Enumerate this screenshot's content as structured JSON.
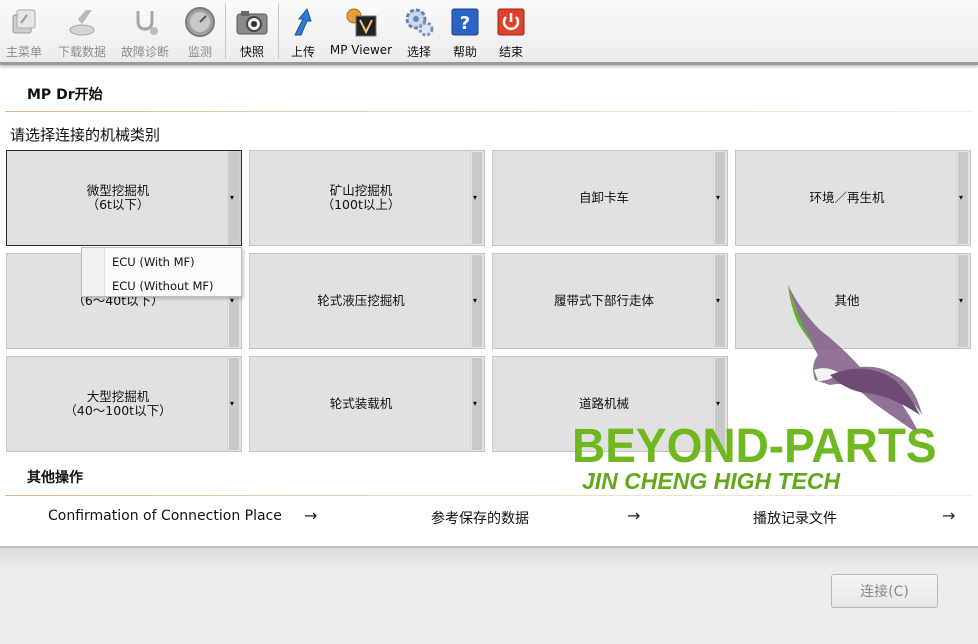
{
  "toolbar": {
    "buttons": [
      {
        "label": "主菜单",
        "icon": "main-menu-icon",
        "enabled": false
      },
      {
        "label": "下载数据",
        "icon": "download-icon",
        "enabled": false
      },
      {
        "label": "故障诊断",
        "icon": "stethoscope-icon",
        "enabled": false
      },
      {
        "label": "监测",
        "icon": "gauge-icon",
        "enabled": false
      },
      {
        "label": "快照",
        "icon": "camera-icon",
        "enabled": true
      },
      {
        "label": "上传",
        "icon": "upload-icon",
        "enabled": true
      },
      {
        "label": "MP Viewer",
        "icon": "mp-viewer-icon",
        "enabled": true
      },
      {
        "label": "选择",
        "icon": "gears-icon",
        "enabled": true
      },
      {
        "label": "帮助",
        "icon": "help-icon",
        "enabled": true
      },
      {
        "label": "结束",
        "icon": "power-icon",
        "enabled": true
      }
    ]
  },
  "header": {
    "title": "MP Dr开始"
  },
  "prompt": "请选择连接的机械类别",
  "categories": [
    {
      "line1": "微型挖掘机",
      "line2": "（6t以下）",
      "selected": true
    },
    {
      "line1": "矿山挖掘机",
      "line2": "（100t以上）"
    },
    {
      "line1": "自卸卡车",
      "line2": ""
    },
    {
      "line1": "环境／再生机",
      "line2": ""
    },
    {
      "line1": "",
      "line2": "（6～40t以下）"
    },
    {
      "line1": "轮式液压挖掘机",
      "line2": ""
    },
    {
      "line1": "履带式下部行走体",
      "line2": ""
    },
    {
      "line1": "其他",
      "line2": ""
    },
    {
      "line1": "大型挖掘机",
      "line2": "（40～100t以下）"
    },
    {
      "line1": "轮式装载机",
      "line2": ""
    },
    {
      "line1": "道路机械",
      "line2": ""
    }
  ],
  "dropdown": {
    "items": [
      "ECU (With MF)",
      "ECU (Without MF)"
    ]
  },
  "other_ops": {
    "title": "其他操作",
    "items": [
      {
        "label": "Confirmation of Connection Place",
        "arrow": "→"
      },
      {
        "label": "参考保存的数据",
        "arrow": "→"
      },
      {
        "label": "播放记录文件",
        "arrow": "→"
      }
    ]
  },
  "connect_button": "连接(C)",
  "dropdown_glyph": "▾",
  "watermark": {
    "brand": "BEYOND-PARTS",
    "tagline": "JIN CHENG HIGH TECH",
    "color": "#6fb81f"
  }
}
